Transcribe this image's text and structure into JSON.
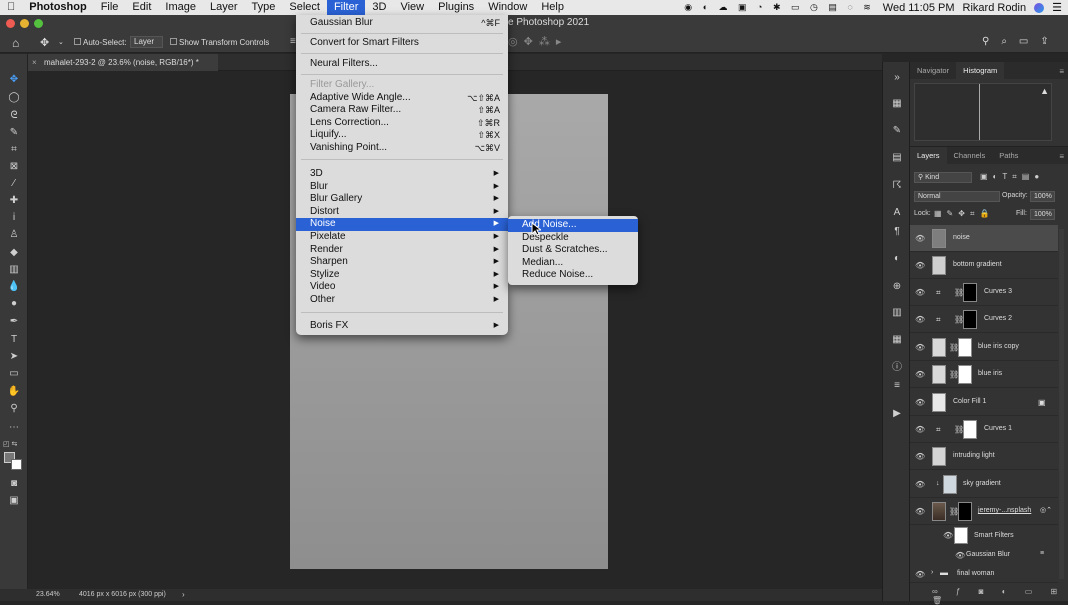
{
  "menubar": {
    "app": "Photoshop",
    "items": [
      "File",
      "Edit",
      "Image",
      "Layer",
      "Type",
      "Select",
      "Filter",
      "3D",
      "View",
      "Plugins",
      "Window",
      "Help"
    ],
    "active": "Filter",
    "clock": "Wed 11:05 PM",
    "user": "Rikard Rodin"
  },
  "window_title_fragment": "e Photoshop 2021",
  "options_bar": {
    "auto_select_label": "Auto-Select:",
    "auto_select_value": "Layer",
    "show_transform_label": "Show Transform Controls"
  },
  "document": {
    "tab_title": "mahalet-293-2 @ 23.6% (noise, RGB/16*) *",
    "zoom": "23.64%",
    "dimensions": "4016 px x 6016 px (300 ppi)"
  },
  "filter_menu": {
    "last_filter": "Gaussian Blur",
    "last_filter_shortcut": "^⌘F",
    "convert_smart": "Convert for Smart Filters",
    "neural": "Neural Filters...",
    "filter_gallery": "Filter Gallery...",
    "adaptive_wide": "Adaptive Wide Angle...",
    "adaptive_wide_shortcut": "⌥⇧⌘A",
    "camera_raw": "Camera Raw Filter...",
    "camera_raw_shortcut": "⇧⌘A",
    "lens_correction": "Lens Correction...",
    "lens_correction_shortcut": "⇧⌘R",
    "liquify": "Liquify...",
    "liquify_shortcut": "⇧⌘X",
    "vanishing": "Vanishing Point...",
    "vanishing_shortcut": "⌥⌘V",
    "submenus": [
      "3D",
      "Blur",
      "Blur Gallery",
      "Distort",
      "Noise",
      "Pixelate",
      "Render",
      "Sharpen",
      "Stylize",
      "Video",
      "Other"
    ],
    "highlighted": "Noise",
    "boris": "Boris FX"
  },
  "noise_menu": {
    "items": [
      "Add Noise...",
      "Despeckle",
      "Dust & Scratches...",
      "Median...",
      "Reduce Noise..."
    ],
    "highlighted": "Add Noise..."
  },
  "nav_panel": {
    "tabs": [
      "Navigator",
      "Histogram"
    ],
    "active": "Histogram"
  },
  "layers_panel": {
    "tabs": [
      "Layers",
      "Channels",
      "Paths"
    ],
    "active": "Layers",
    "kind": "Kind",
    "blend_mode": "Normal",
    "opacity_label": "Opacity:",
    "opacity": "100%",
    "lock_label": "Lock:",
    "fill_label": "Fill:",
    "fill": "100%",
    "layers": [
      "noise",
      "bottom gradient",
      "Curves 3",
      "Curves 2",
      "blue iris copy",
      "blue iris",
      "Color Fill 1",
      "Curves 1",
      "intruding light",
      "sky gradient",
      "jeremy-...nsplash",
      "Smart Filters",
      "Gaussian Blur",
      "final woman"
    ],
    "selected": "noise"
  }
}
